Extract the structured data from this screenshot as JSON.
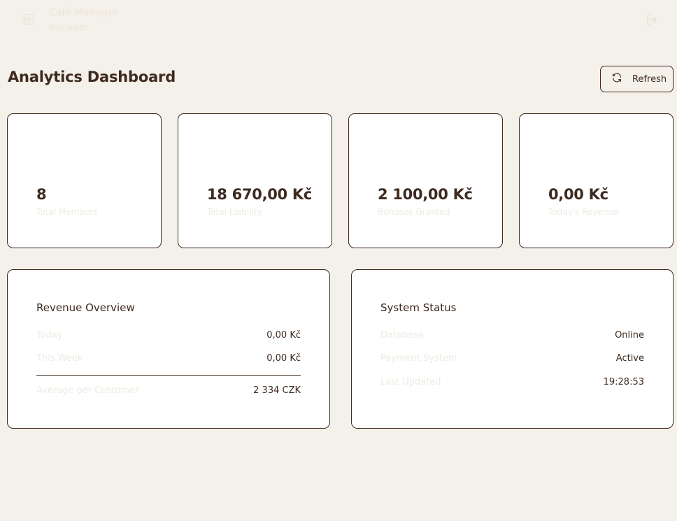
{
  "app": {
    "name": "Café Manager",
    "role": "manager",
    "brand_icon": "store-icon",
    "logout_icon": "logout-icon"
  },
  "header": {
    "title": "Analytics Dashboard",
    "refresh_label": "Refresh",
    "refresh_icon": "refresh-icon"
  },
  "stats": [
    {
      "value": "8",
      "label": "Total Members"
    },
    {
      "value": "18 670,00 Kč",
      "label": "Total Liability"
    },
    {
      "value": "2 100,00 Kč",
      "label": "Bonuses Granted"
    },
    {
      "value": "0,00 Kč",
      "label": "Today's Revenue"
    }
  ],
  "revenue": {
    "title": "Revenue Overview",
    "rows": [
      {
        "label": "Today",
        "value": "0,00 Kč"
      },
      {
        "label": "This Week",
        "value": "0,00 Kč"
      }
    ],
    "average": {
      "label": "Average per Customer",
      "value": "2 334 CZK"
    }
  },
  "system": {
    "title": "System Status",
    "rows": [
      {
        "label": "Database",
        "value": "Online"
      },
      {
        "label": "Payment System",
        "value": "Active"
      },
      {
        "label": "Last Updated",
        "value": "19:28:53"
      }
    ]
  },
  "colors": {
    "background": "#f4f1ea",
    "text": "#3e2a1f",
    "card": "#ffffff",
    "faint_text": "#efebe3"
  }
}
